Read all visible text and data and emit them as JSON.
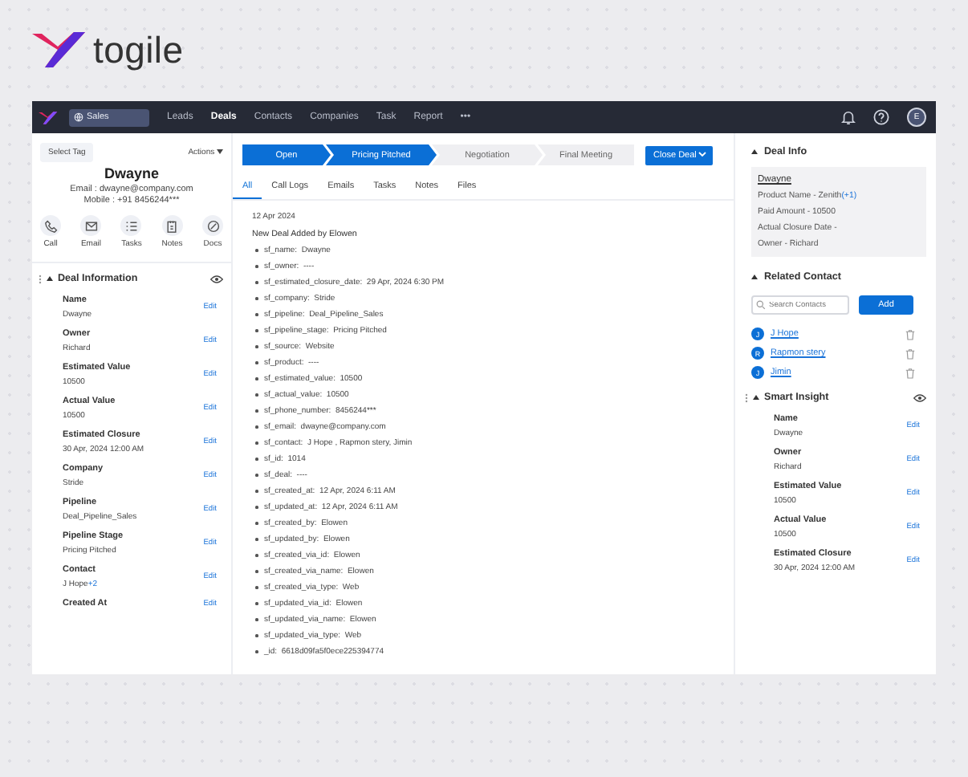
{
  "brand": {
    "name": "togile"
  },
  "nav": {
    "workspace": "Sales",
    "items": [
      {
        "label": "Leads",
        "selected": false
      },
      {
        "label": "Deals",
        "selected": true
      },
      {
        "label": "Contacts",
        "selected": false
      },
      {
        "label": "Companies",
        "selected": false
      },
      {
        "label": "Task",
        "selected": false
      },
      {
        "label": "Report",
        "selected": false
      }
    ],
    "more": "•••",
    "avatar": "E"
  },
  "left": {
    "tag_button": "Select Tag",
    "actions": "Actions",
    "name": "Dwayne",
    "email": "Email : dwayne@company.com",
    "mobile": "Mobile : +91 8456244***",
    "quick_actions": [
      {
        "kind": "call",
        "label": "Call"
      },
      {
        "kind": "email",
        "label": "Email"
      },
      {
        "kind": "tasks",
        "label": "Tasks"
      },
      {
        "kind": "notes",
        "label": "Notes"
      },
      {
        "kind": "docs",
        "label": "Docs"
      }
    ],
    "section_title": "Deal Information",
    "fields": [
      {
        "label": "Name",
        "value": "Dwayne",
        "edit": "Edit"
      },
      {
        "label": "Owner",
        "value": "Richard",
        "edit": "Edit"
      },
      {
        "label": "Estimated Value",
        "value": "10500",
        "edit": "Edit"
      },
      {
        "label": "Actual Value",
        "value": "10500",
        "edit": "Edit"
      },
      {
        "label": "Estimated Closure",
        "value": "30 Apr, 2024 12:00 AM",
        "edit": "Edit"
      },
      {
        "label": "Company",
        "value": "Stride",
        "edit": "Edit"
      },
      {
        "label": "Pipeline",
        "value": "Deal_Pipeline_Sales",
        "edit": "Edit"
      },
      {
        "label": "Pipeline Stage",
        "value": "Pricing Pitched",
        "edit": "Edit"
      },
      {
        "label": "Contact",
        "value": "J Hope",
        "extra": "+2",
        "edit": "Edit"
      },
      {
        "label": "Created At",
        "edit": "Edit"
      }
    ]
  },
  "stages": [
    {
      "label": "Open",
      "completed": true
    },
    {
      "label": "Pricing Pitched",
      "completed": true
    },
    {
      "label": "Negotiation",
      "completed": false
    },
    {
      "label": "Final Meeting",
      "completed": false
    }
  ],
  "close_button": "Close Deal",
  "tabs": [
    {
      "label": "All",
      "selected": true
    },
    {
      "label": "Call Logs",
      "selected": false
    },
    {
      "label": "Emails",
      "selected": false
    },
    {
      "label": "Tasks",
      "selected": false
    },
    {
      "label": "Notes",
      "selected": false
    },
    {
      "label": "Files",
      "selected": false
    }
  ],
  "activity": {
    "date": "12 Apr 2024",
    "title": "New Deal Added by Elowen",
    "entries": [
      {
        "key": "sf_name:",
        "value": "Dwayne"
      },
      {
        "key": "sf_owner:",
        "value": "----"
      },
      {
        "key": "sf_estimated_closure_date:",
        "value": "29 Apr, 2024 6:30 PM"
      },
      {
        "key": "sf_company:",
        "value": "Stride"
      },
      {
        "key": "sf_pipeline:",
        "value": "Deal_Pipeline_Sales"
      },
      {
        "key": "sf_pipeline_stage:",
        "value": "Pricing Pitched"
      },
      {
        "key": "sf_source:",
        "value": "Website"
      },
      {
        "key": "sf_product:",
        "value": "----"
      },
      {
        "key": "sf_estimated_value:",
        "value": "10500"
      },
      {
        "key": "sf_actual_value:",
        "value": "10500"
      },
      {
        "key": "sf_phone_number:",
        "value": "8456244***"
      },
      {
        "key": "sf_email:",
        "value": "dwayne@company.com"
      },
      {
        "key": "sf_contact:",
        "value": "J Hope , Rapmon stery, Jimin"
      },
      {
        "key": "sf_id:",
        "value": "1014"
      },
      {
        "key": "sf_deal:",
        "value": "----"
      },
      {
        "key": "sf_created_at:",
        "value": "12 Apr, 2024 6:11 AM"
      },
      {
        "key": "sf_updated_at:",
        "value": "12 Apr, 2024 6:11 AM"
      },
      {
        "key": "sf_created_by:",
        "value": "Elowen"
      },
      {
        "key": "sf_updated_by:",
        "value": "Elowen"
      },
      {
        "key": "sf_created_via_id:",
        "value": "Elowen"
      },
      {
        "key": "sf_created_via_name:",
        "value": "Elowen"
      },
      {
        "key": "sf_created_via_type:",
        "value": "Web"
      },
      {
        "key": "sf_updated_via_id:",
        "value": "Elowen"
      },
      {
        "key": "sf_updated_via_name:",
        "value": "Elowen"
      },
      {
        "key": "sf_updated_via_type:",
        "value": "Web"
      },
      {
        "key": "_id:",
        "value": "6618d09fa5f0ece225394774"
      }
    ]
  },
  "right": {
    "deal_info": {
      "title": "Deal Info",
      "name": "Dwayne",
      "lines": [
        {
          "text": "Product Name - Zenith",
          "extra": "(+1)"
        },
        {
          "text": "Paid Amount - 10500"
        },
        {
          "text": "Actual Closure Date -"
        },
        {
          "text": "Owner - Richard"
        }
      ]
    },
    "related": {
      "title": "Related Contact",
      "search_placeholder": "Search Contacts",
      "add": "Add",
      "contacts": [
        {
          "initial": "J",
          "name": "J Hope"
        },
        {
          "initial": "R",
          "name": "Rapmon stery"
        },
        {
          "initial": "J",
          "name": "Jimin"
        }
      ]
    },
    "insight": {
      "title": "Smart Insight",
      "fields": [
        {
          "label": "Name",
          "value": "Dwayne",
          "edit": "Edit"
        },
        {
          "label": "Owner",
          "value": "Richard",
          "edit": "Edit"
        },
        {
          "label": "Estimated Value",
          "value": "10500",
          "edit": "Edit"
        },
        {
          "label": "Actual Value",
          "value": "10500",
          "edit": "Edit"
        },
        {
          "label": "Estimated Closure",
          "value": "30 Apr, 2024 12:00 AM",
          "edit": "Edit"
        }
      ]
    }
  }
}
